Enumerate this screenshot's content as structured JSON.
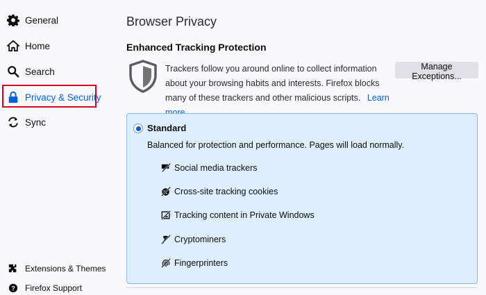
{
  "sidebar": {
    "items": [
      {
        "label": "General",
        "icon": "gear-icon"
      },
      {
        "label": "Home",
        "icon": "home-icon"
      },
      {
        "label": "Search",
        "icon": "search-icon"
      },
      {
        "label": "Privacy & Security",
        "icon": "lock-icon",
        "selected": true
      },
      {
        "label": "Sync",
        "icon": "sync-icon"
      }
    ],
    "footer": [
      {
        "label": "Extensions & Themes",
        "icon": "puzzle-icon"
      },
      {
        "label": "Firefox Support",
        "icon": "help-icon"
      }
    ]
  },
  "main": {
    "title": "Browser Privacy",
    "section_title": "Enhanced Tracking Protection",
    "description": "Trackers follow you around online to collect information about your browsing habits and interests. Firefox blocks many of these trackers and other malicious scripts.",
    "learn_more": "Learn more",
    "manage_button": "Manage Exceptions...",
    "standard": {
      "label": "Standard",
      "description": "Balanced for protection and performance. Pages will load normally.",
      "features": [
        {
          "label": "Social media trackers",
          "icon": "social-tracker-icon"
        },
        {
          "label": "Cross-site tracking cookies",
          "icon": "cookie-icon"
        },
        {
          "label": "Tracking content in Private Windows",
          "icon": "tracking-content-icon"
        },
        {
          "label": "Cryptominers",
          "icon": "cryptominer-icon"
        },
        {
          "label": "Fingerprinters",
          "icon": "fingerprint-icon"
        }
      ]
    }
  },
  "colors": {
    "accent": "#0061e0",
    "highlight_box": "#d70022",
    "card_background": "#deeefc",
    "card_border": "#85b7ee"
  }
}
